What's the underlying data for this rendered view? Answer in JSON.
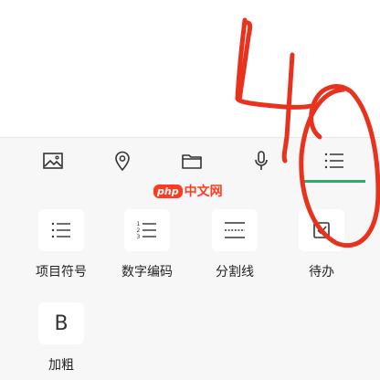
{
  "toolbar": {
    "items": [
      {
        "icon": "image-icon"
      },
      {
        "icon": "location-pin-icon"
      },
      {
        "icon": "folder-icon"
      },
      {
        "icon": "microphone-icon"
      },
      {
        "icon": "list-icon",
        "active": true
      }
    ],
    "active_color": "#2aae67"
  },
  "panel": {
    "items": [
      {
        "label": "项目符号",
        "icon": "bulleted-list-icon"
      },
      {
        "label": "数字编码",
        "icon": "numbered-list-icon"
      },
      {
        "label": "分割线",
        "icon": "divider-icon"
      },
      {
        "label": "待办",
        "icon": "checkbox-icon"
      },
      {
        "label": "加粗",
        "icon": "bold-icon",
        "glyph": "B"
      }
    ]
  },
  "watermark": {
    "brand": "php",
    "text": "中文网",
    "color": "#ff3b1f"
  },
  "annotation": {
    "handwritten_text": "40",
    "color": "#e8321e"
  }
}
